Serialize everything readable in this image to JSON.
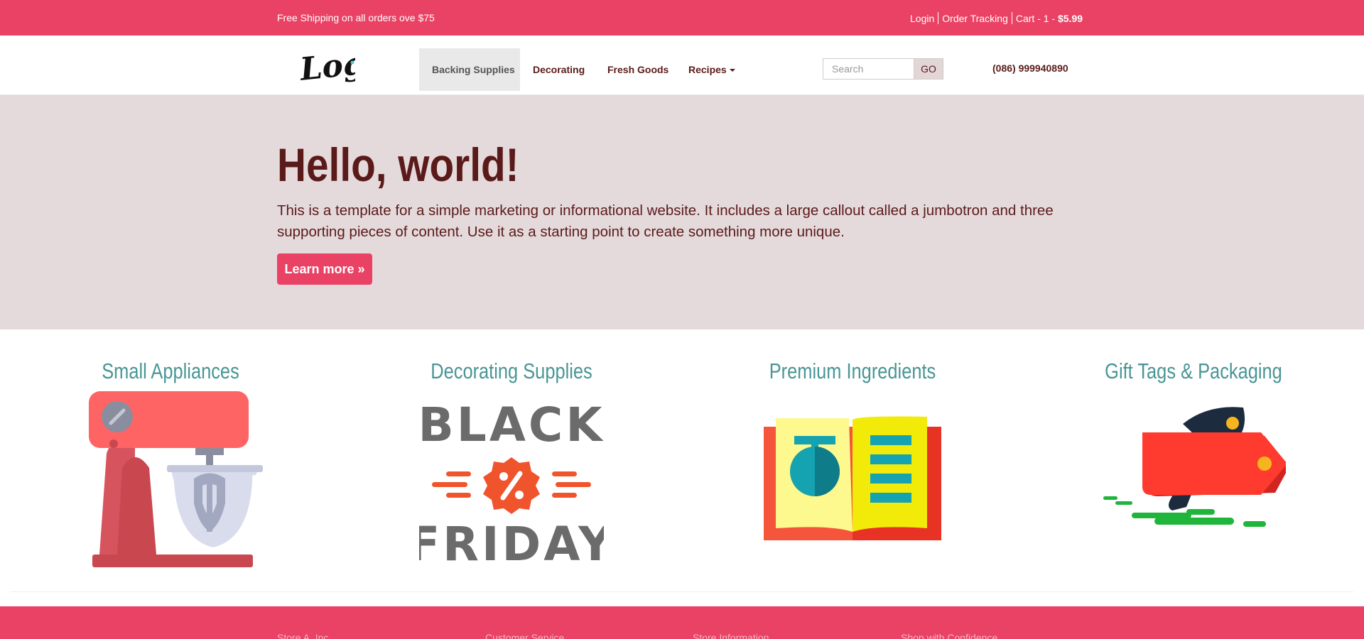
{
  "topbar": {
    "shipping_text": "Free Shipping on all orders ove $75",
    "login": "Login",
    "order_tracking": "Order Tracking",
    "cart_label": "Cart - 1 - ",
    "cart_price": "$5.99"
  },
  "nav": {
    "logo_text": "Logo",
    "items": [
      "Backing Supplies",
      "Decorating",
      "Fresh Goods",
      "Recipes"
    ],
    "search_placeholder": "Search",
    "go_label": "GO",
    "phone": "(086) 999940890"
  },
  "jumbotron": {
    "title": "Hello, world!",
    "text": "This is a template for a simple marketing or informational website. It includes a large callout called a jumbotron and three supporting pieces of content. Use it as a starting point to create something more unique.",
    "button": "Learn more »"
  },
  "features": [
    {
      "title": "Small Appliances",
      "icon": "stand-mixer-icon"
    },
    {
      "title": "Decorating Supplies",
      "icon": "black-friday-icon",
      "art_top": "BLACK",
      "art_bottom": "FRIDAY"
    },
    {
      "title": "Premium Ingredients",
      "icon": "recipe-book-icon"
    },
    {
      "title": "Gift Tags & Packaging",
      "icon": "flying-tag-icon"
    }
  ],
  "footer": {
    "columns": [
      "Store A, Inc",
      "Customer Service",
      "Store Information",
      "Shop with Confidence"
    ]
  },
  "colors": {
    "brand": "#ea4264",
    "text": "#5b1a1a",
    "jumbotron_bg": "#e5dadb",
    "feature_title": "#4a9595"
  }
}
